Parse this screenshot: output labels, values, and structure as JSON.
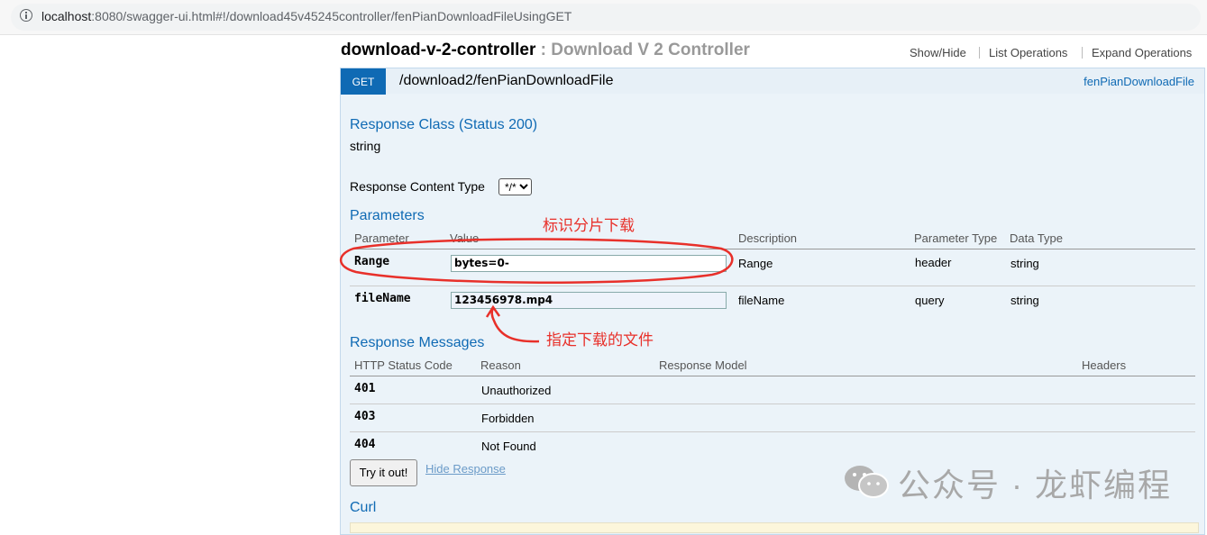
{
  "browser": {
    "url_host": "localhost",
    "url_rest": ":8080/swagger-ui.html#!/download45v45245controller/fenPianDownloadFileUsingGET"
  },
  "controller": {
    "name": "download-v-2-controller",
    "separator": " : ",
    "description": "Download V 2 Controller",
    "links": [
      "Show/Hide",
      "List Operations",
      "Expand Operations"
    ]
  },
  "operation": {
    "method": "GET",
    "path": "/download2/fenPianDownloadFile",
    "nickname": "fenPianDownloadFile"
  },
  "response_class": {
    "heading": "Response Class (Status 200)",
    "type": "string"
  },
  "content_type": {
    "label": "Response Content Type",
    "selected": "*/*"
  },
  "parameters": {
    "heading": "Parameters",
    "columns": [
      "Parameter",
      "Value",
      "Description",
      "Parameter Type",
      "Data Type"
    ],
    "rows": [
      {
        "name": "Range",
        "value": "bytes=0-",
        "description": "Range",
        "param_type": "header",
        "data_type": "string"
      },
      {
        "name": "fileName",
        "value": "123456978.mp4",
        "description": "fileName",
        "param_type": "query",
        "data_type": "string"
      }
    ]
  },
  "response_messages": {
    "heading": "Response Messages",
    "columns": [
      "HTTP Status Code",
      "Reason",
      "Response Model",
      "Headers"
    ],
    "rows": [
      {
        "code": "401",
        "reason": "Unauthorized"
      },
      {
        "code": "403",
        "reason": "Forbidden"
      },
      {
        "code": "404",
        "reason": "Not Found"
      }
    ]
  },
  "actions": {
    "try_label": "Try it out!",
    "hide_label": "Hide Response"
  },
  "curl": {
    "heading": "Curl"
  },
  "annotations": {
    "range_note": "标识分片下载",
    "file_note": "指定下载的文件",
    "color": "#e8302a"
  },
  "watermark": {
    "text": "公众号 · 龙虾编程",
    "icon": "wechat-icon"
  }
}
